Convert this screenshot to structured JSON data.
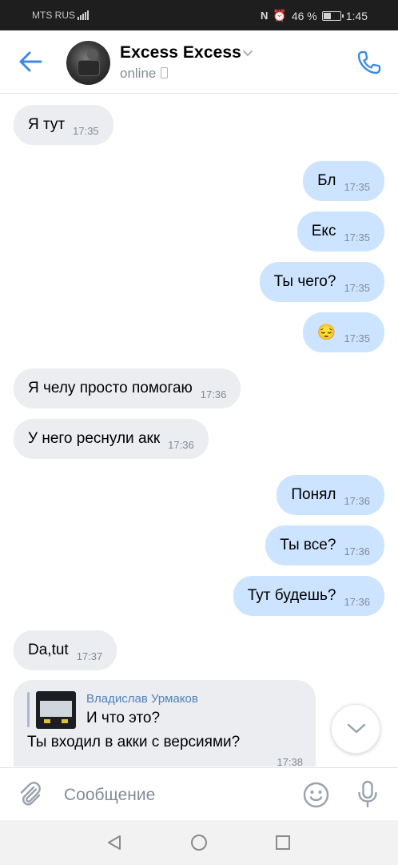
{
  "status_bar": {
    "carrier": "MTS RUS",
    "network": "4G",
    "battery_percent": "46 %",
    "battery_level": 0.46,
    "clock": "1:45"
  },
  "header": {
    "contact_name": "Excess Excess",
    "presence": "online"
  },
  "messages": [
    {
      "dir": "in",
      "text": "Я тут",
      "time": "17:35"
    },
    {
      "dir": "out",
      "text": "Бл",
      "time": "17:35"
    },
    {
      "dir": "out",
      "text": "Екс",
      "time": "17:35"
    },
    {
      "dir": "out",
      "text": "Ты чего?",
      "time": "17:35"
    },
    {
      "dir": "out",
      "text": "😔",
      "time": "17:35"
    },
    {
      "dir": "in",
      "text": "Я челу просто помогаю",
      "time": "17:36"
    },
    {
      "dir": "in",
      "text": "У него реснули акк",
      "time": "17:36"
    },
    {
      "dir": "out",
      "text": "Понял",
      "time": "17:36"
    },
    {
      "dir": "out",
      "text": "Ты все?",
      "time": "17:36"
    },
    {
      "dir": "out",
      "text": "Тут будешь?",
      "time": "17:36"
    },
    {
      "dir": "in",
      "text": "Da,tut",
      "time": "17:37"
    }
  ],
  "reply_message": {
    "quoted_author": "Владислав Урмаков",
    "quoted_text": "И что это?",
    "text": "Ты входил в акки с версиями?",
    "time": "17:38"
  },
  "composer": {
    "placeholder": "Сообщение"
  },
  "icons": {
    "back": "arrow-left-icon",
    "call": "phone-icon",
    "attach": "paperclip-icon",
    "emoji": "smile-icon",
    "voice": "microphone-icon",
    "scroll": "chevron-down-icon"
  },
  "colors": {
    "accent": "#3f8ae0",
    "incoming_bubble": "#ebedf0",
    "outgoing_bubble": "#cce4ff",
    "author_link": "#5181b8",
    "secondary_text": "#818c99"
  }
}
